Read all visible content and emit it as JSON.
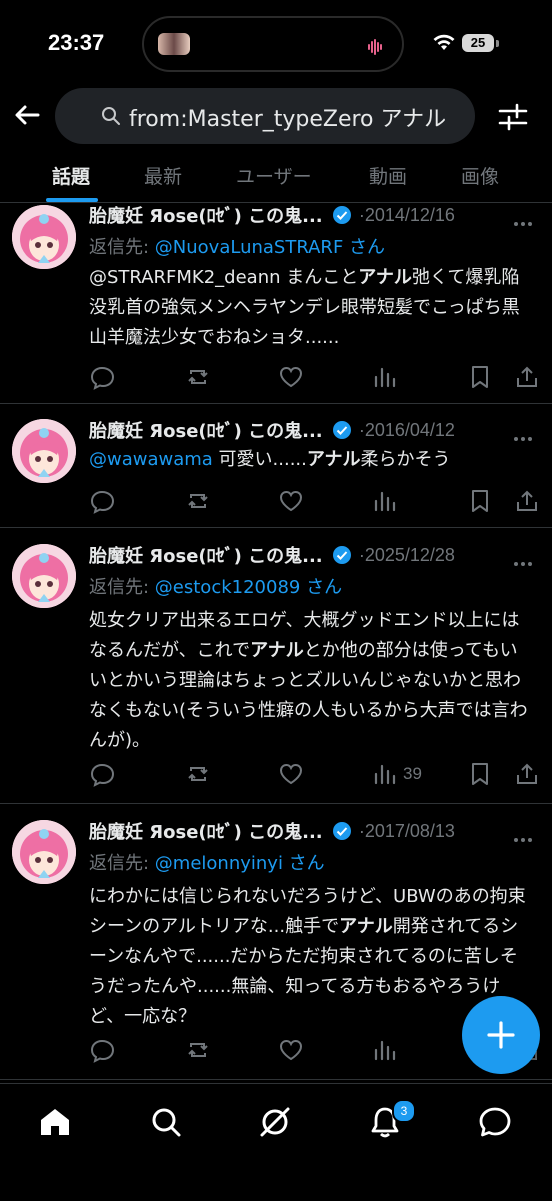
{
  "status_bar": {
    "time": "23:37",
    "battery": "25"
  },
  "search": {
    "query": "from:Master_typeZero アナル"
  },
  "tabs": [
    {
      "label": "話題",
      "active": true
    },
    {
      "label": "最新",
      "active": false
    },
    {
      "label": "ユーザー",
      "active": false
    },
    {
      "label": "動画",
      "active": false
    },
    {
      "label": "画像",
      "active": false
    }
  ],
  "posts": [
    {
      "name": "胎魔妊 Яose(ﾛｾﾞ) この鬼...",
      "date": "2014/12/16",
      "reply_prefix": "返信先: ",
      "reply_handle": "@NuovaLunaSTRARF",
      "reply_suffix": " さん",
      "body_parts": [
        "@STRARFMK2_deann まんこと",
        "アナル",
        "弛くて爆乳陥没乳首の強気メンヘラヤンデレ眼帯短髪でこっぱち黒山羊魔法少女でおねショタ......"
      ],
      "views": ""
    },
    {
      "name": "胎魔妊 Яose(ﾛｾﾞ) この鬼...",
      "date": "2016/04/12",
      "body_mention": "@wawawama",
      "body_parts": [
        " 可愛い......",
        "アナル",
        "柔らかそう"
      ],
      "views": ""
    },
    {
      "name": "胎魔妊 Яose(ﾛｾﾞ) この鬼...",
      "date": "2025/12/28",
      "reply_prefix": "返信先: ",
      "reply_handle": "@estock120089",
      "reply_suffix": " さん",
      "body_parts": [
        "処女クリア出来るエロゲ、大概グッドエンド以上にはなるんだが、これで",
        "アナル",
        "とか他の部分は使ってもいいとかいう理論はちょっとズルいんじゃないかと思わなくもない(そういう性癖の人もいるから大声では言わんが)。"
      ],
      "views": "39"
    },
    {
      "name": "胎魔妊 Яose(ﾛｾﾞ) この鬼...",
      "date": "2017/08/13",
      "reply_prefix": "返信先: ",
      "reply_handle": "@melonnyinyi",
      "reply_suffix": " さん",
      "body_parts": [
        "にわかには信じられないだろうけど、UBWのあの拘束シーンのアルトリアな...触手で",
        "アナル",
        "開発されてるシーンなんやで......だからただ拘束されてるのに苦しそうだったんや......無論、知ってる方もおるやろうけど、一応な？"
      ],
      "views": ""
    }
  ],
  "notifications": {
    "badge": "3"
  },
  "icons": {
    "back": "arrow-left-icon",
    "filter": "sliders-icon",
    "fab": "plus-icon",
    "nav": [
      "home-icon",
      "search-icon",
      "grok-icon",
      "bell-icon",
      "messages-icon"
    ]
  },
  "colors": {
    "accent": "#1d9bf0",
    "background": "#000000",
    "muted": "#71767b",
    "text": "#e7e9ea"
  }
}
